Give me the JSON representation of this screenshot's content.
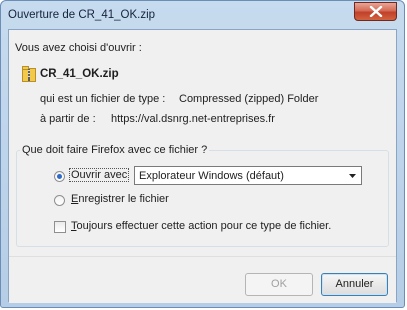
{
  "window": {
    "title": "Ouverture de CR_41_OK.zip"
  },
  "dialog": {
    "intro": "Vous avez choisi d'ouvrir :",
    "file_name": "CR_41_OK.zip",
    "file_type_label": "qui est un fichier de type :",
    "file_type_value": "Compressed (zipped) Folder",
    "source_label": "à partir de :",
    "source_value": "https://val.dsnrg.net-entreprises.fr"
  },
  "action_group": {
    "legend": "Que doit faire Firefox avec ce fichier ?",
    "open_with_label": "Ouvrir avec",
    "open_with_selected": true,
    "open_with_app": "Explorateur Windows (défaut)",
    "save_label": "Enregistrer le fichier",
    "save_selected": false,
    "always_label": "Toujours effectuer cette action pour ce type de fichier.",
    "always_checked": false
  },
  "buttons": {
    "ok_label": "OK",
    "cancel_label": "Annuler"
  }
}
